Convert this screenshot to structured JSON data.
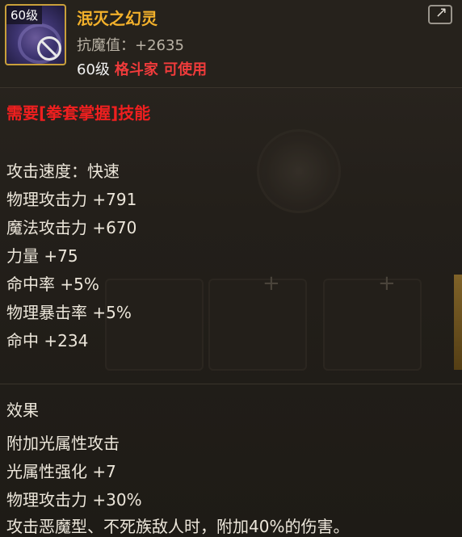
{
  "item": {
    "level_badge": "60级",
    "name": "泯灭之幻灵",
    "resist": "抗魔值：+2635",
    "usable_level": "60级",
    "usable_job": "格斗家 可使用"
  },
  "requirement": "需要[拳套掌握]技能",
  "stats": [
    "攻击速度：快速",
    "物理攻击力 +791",
    "魔法攻击力 +670",
    "力量 +75",
    "命中率 +5%",
    "物理暴击率 +5%",
    "命中 +234"
  ],
  "effects_title": "效果",
  "effects": [
    "附加光属性攻击",
    "光属性强化 +7",
    "物理攻击力 +30%",
    "攻击恶魔型、不死族敌人时，附加40%的伤害。"
  ],
  "colors": {
    "title": "#f3b12b",
    "requirement": "#ef1f1f",
    "job": "#ef3b3b",
    "icon_border": "#c9a03a"
  },
  "icons": {
    "item_icon": "phantom-knuckle-icon",
    "ban_icon": "no-entry-icon",
    "share_icon": "share-icon"
  }
}
